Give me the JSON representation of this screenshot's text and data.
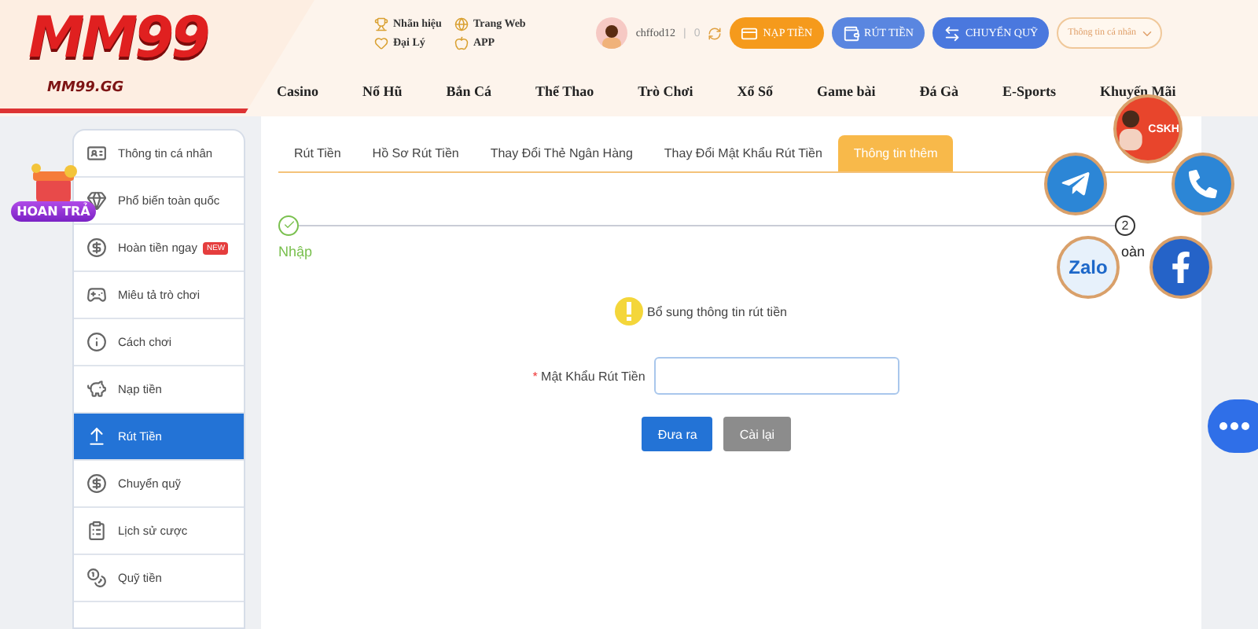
{
  "logo": {
    "title": "MM99",
    "domain": "MM99.GG"
  },
  "top_links": [
    {
      "label": "Nhãn hiệu",
      "kind": "trophy"
    },
    {
      "label": "Trang Web",
      "kind": "globe"
    },
    {
      "label": "Đại Lý",
      "kind": "heart"
    },
    {
      "label": "APP",
      "kind": "apple"
    }
  ],
  "user": {
    "name": "chffod12",
    "separator": "|",
    "balance": "0"
  },
  "actions": [
    {
      "label": "NẠP TIỀN",
      "kind": "deposit"
    },
    {
      "label": "RÚT TIỀN",
      "kind": "withdraw"
    },
    {
      "label": "CHUYỂN QUỸ",
      "kind": "transfer"
    }
  ],
  "profile_menu": {
    "label": "Thông tin cá nhân"
  },
  "nav": [
    "Casino",
    "Nổ Hũ",
    "Bắn Cá",
    "Thể Thao",
    "Trò Chơi",
    "Xổ Số",
    "Game bài",
    "Đá Gà",
    "E-Sports",
    "Khuyến Mãi"
  ],
  "promo_badge": {
    "label": "HOAN TRẢ"
  },
  "sidebar": [
    {
      "label": "Thông tin cá nhân",
      "kind": "id",
      "selected": false
    },
    {
      "label": "Phổ biến toàn quốc",
      "kind": "diamond",
      "selected": false
    },
    {
      "label": "Hoàn tiền ngay",
      "kind": "coin",
      "selected": false,
      "badge": "NEW"
    },
    {
      "label": "Miêu tả trò chơi",
      "kind": "gamepad",
      "selected": false
    },
    {
      "label": "Cách chơi",
      "kind": "info",
      "selected": false
    },
    {
      "label": "Nạp tiền",
      "kind": "piggy",
      "selected": false
    },
    {
      "label": "Rút Tiền",
      "kind": "withdraw",
      "selected": true
    },
    {
      "label": "Chuyển quỹ",
      "kind": "dollar",
      "selected": false
    },
    {
      "label": "Lịch sử cược",
      "kind": "clipboard",
      "selected": false
    },
    {
      "label": "Quỹ tiền",
      "kind": "coins",
      "selected": false
    }
  ],
  "tabs": [
    {
      "label": "Rút Tiền",
      "selected": false
    },
    {
      "label": "Hồ Sơ Rút Tiền",
      "selected": false
    },
    {
      "label": "Thay Đổi Thẻ Ngân Hàng",
      "selected": false
    },
    {
      "label": "Thay Đổi Mật Khẩu Rút Tiền",
      "selected": false
    },
    {
      "label": "Thông tin thêm",
      "selected": true
    }
  ],
  "steps": [
    {
      "label": "Nhập",
      "done": true
    },
    {
      "number": "2",
      "label": "oàn",
      "done": false
    }
  ],
  "notice": "Bổ sung thông tin rút tiền",
  "form": {
    "required_mark": "*",
    "label": "Mật Khẩu Rút Tiền"
  },
  "buttons": [
    {
      "label": "Đưa ra",
      "kind": "primary"
    },
    {
      "label": "Cài lại",
      "kind": "secondary"
    }
  ],
  "contacts": [
    {
      "kind": "support",
      "label": "CSKH"
    },
    {
      "kind": "telegram"
    },
    {
      "kind": "phone"
    },
    {
      "kind": "zalo",
      "label": "Zalo"
    },
    {
      "kind": "facebook"
    }
  ]
}
